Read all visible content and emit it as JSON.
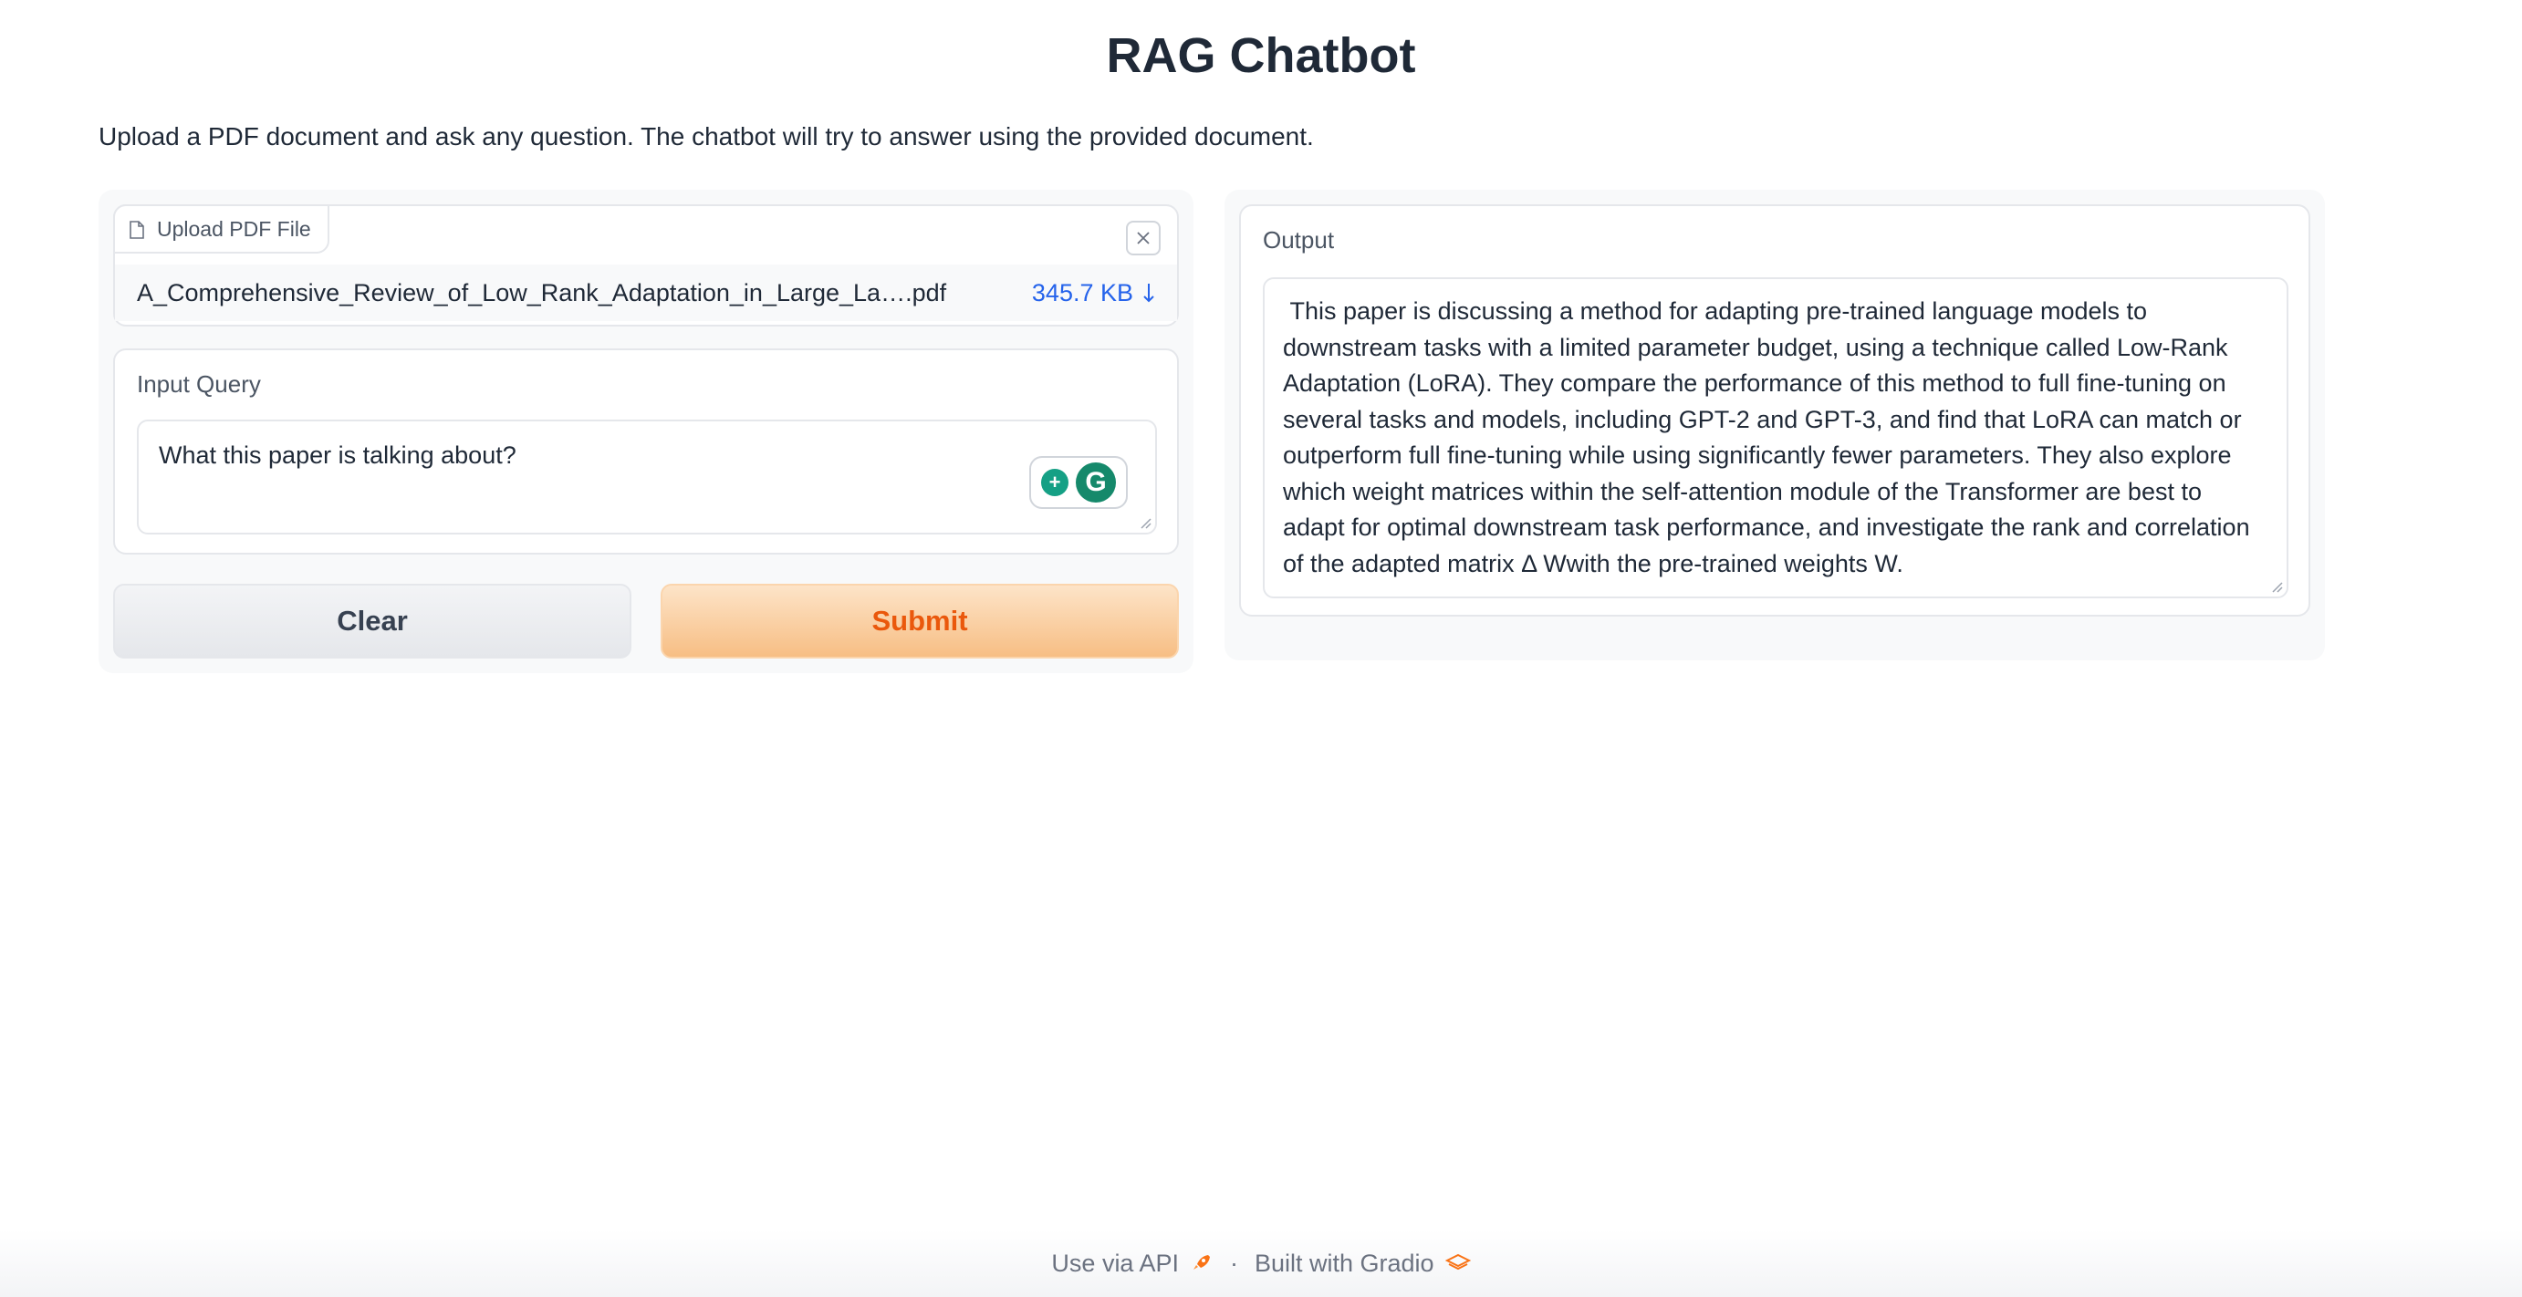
{
  "app": {
    "title": "RAG Chatbot",
    "description": "Upload a PDF document and ask any question. The chatbot will try to answer using the provided document."
  },
  "file_upload": {
    "label": "Upload PDF File",
    "file_name": "A_Comprehensive_Review_of_Low_Rank_Adaptation_in_Large_La….pdf",
    "file_size": "345.7 KB"
  },
  "query": {
    "label": "Input Query",
    "value": "What this paper is talking about?"
  },
  "buttons": {
    "clear": "Clear",
    "submit": "Submit"
  },
  "output": {
    "label": "Output",
    "value": " This paper is discussing a method for adapting pre-trained language models to downstream tasks with a limited parameter budget, using a technique called Low-Rank Adaptation (LoRA). They compare the performance of this method to full fine-tuning on several tasks and models, including GPT-2 and GPT-3, and find that LoRA can match or outperform full fine-tuning while using significantly fewer parameters. They also explore which weight matrices within the self-attention module of the Transformer are best to adapt for optimal downstream task performance, and investigate the rank and correlation of the adapted matrix Δ Wwith the pre-trained weights W."
  },
  "footer": {
    "api_link": "Use via API",
    "separator": "·",
    "built_with": "Built with Gradio"
  },
  "colors": {
    "accent": "#ea580c",
    "link": "#2563eb"
  }
}
